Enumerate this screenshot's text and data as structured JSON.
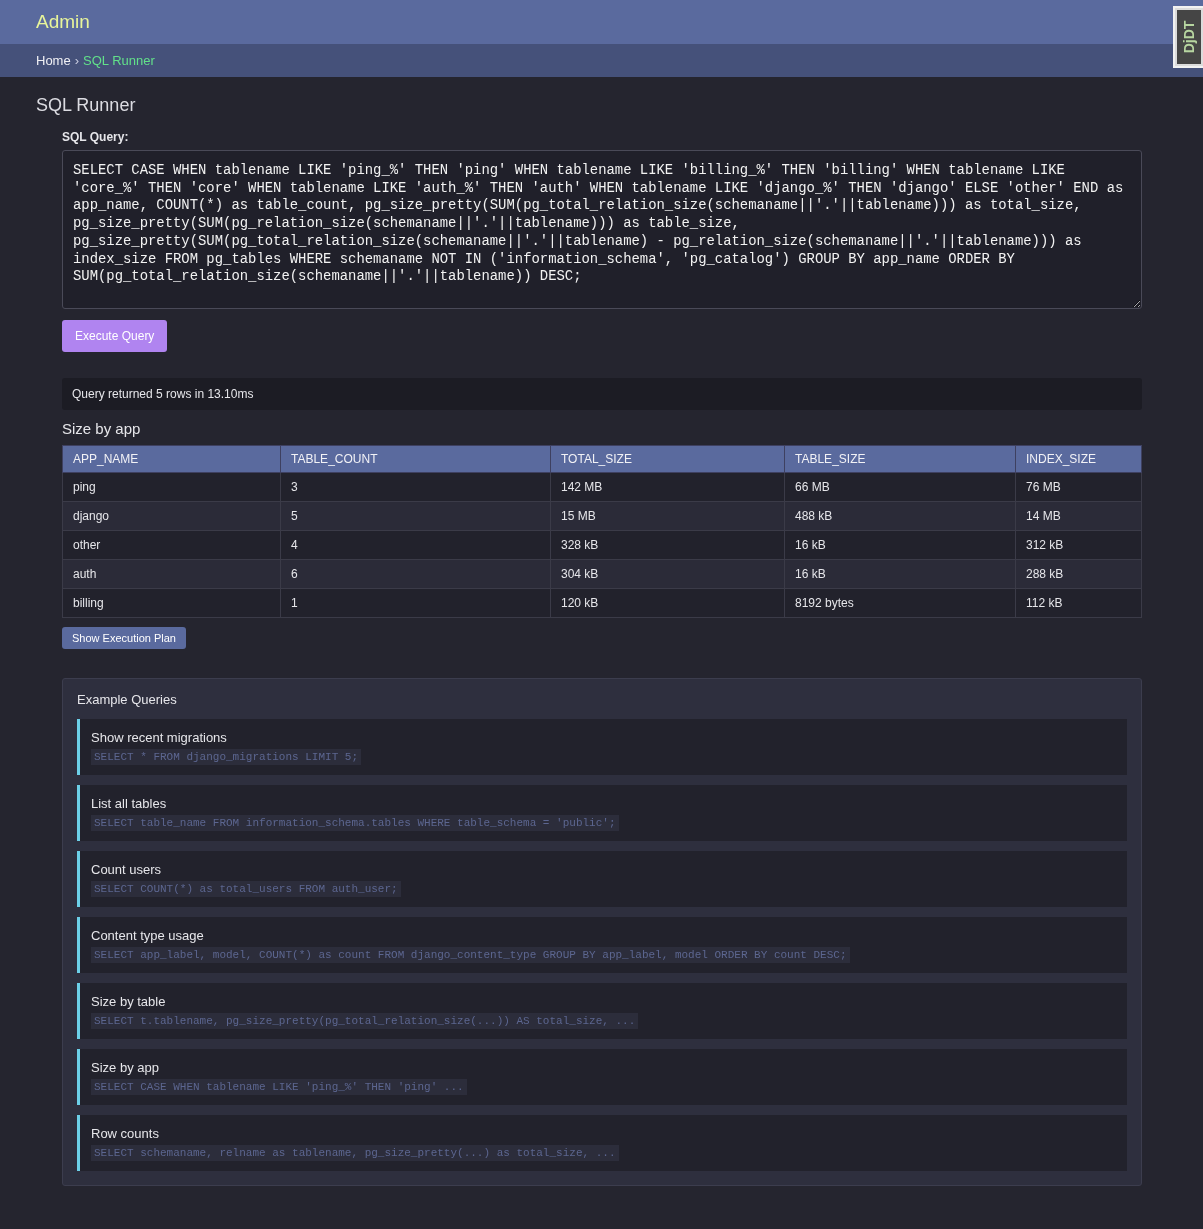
{
  "header": {
    "title": "Admin"
  },
  "breadcrumb": {
    "items": [
      {
        "label": "Home",
        "current": false
      },
      {
        "label": "SQL Runner",
        "current": true
      }
    ],
    "separator": "›"
  },
  "toolbar_handle": {
    "label": "DjDT"
  },
  "page_title": "SQL Runner",
  "query": {
    "label": "SQL Query:",
    "value": "SELECT CASE WHEN tablename LIKE 'ping_%' THEN 'ping' WHEN tablename LIKE 'billing_%' THEN 'billing' WHEN tablename LIKE 'core_%' THEN 'core' WHEN tablename LIKE 'auth_%' THEN 'auth' WHEN tablename LIKE 'django_%' THEN 'django' ELSE 'other' END as app_name, COUNT(*) as table_count, pg_size_pretty(SUM(pg_total_relation_size(schemaname||'.'||tablename))) as total_size, pg_size_pretty(SUM(pg_relation_size(schemaname||'.'||tablename))) as table_size, pg_size_pretty(SUM(pg_total_relation_size(schemaname||'.'||tablename) - pg_relation_size(schemaname||'.'||tablename))) as index_size FROM pg_tables WHERE schemaname NOT IN ('information_schema', 'pg_catalog') GROUP BY app_name ORDER BY SUM(pg_total_relation_size(schemaname||'.'||tablename)) DESC;",
    "button": "Execute Query"
  },
  "status": "Query returned 5 rows in 13.10ms",
  "result": {
    "title": "Size by app",
    "columns": [
      "APP_NAME",
      "TABLE_COUNT",
      "TOTAL_SIZE",
      "TABLE_SIZE",
      "INDEX_SIZE"
    ],
    "rows": [
      [
        "ping",
        "3",
        "142 MB",
        "66 MB",
        "76 MB"
      ],
      [
        "django",
        "5",
        "15 MB",
        "488 kB",
        "14 MB"
      ],
      [
        "other",
        "4",
        "328 kB",
        "16 kB",
        "312 kB"
      ],
      [
        "auth",
        "6",
        "304 kB",
        "16 kB",
        "288 kB"
      ],
      [
        "billing",
        "1",
        "120 kB",
        "8192 bytes",
        "112 kB"
      ]
    ],
    "plan_button": "Show Execution Plan"
  },
  "examples": {
    "title": "Example Queries",
    "items": [
      {
        "name": "Show recent migrations",
        "sql": "SELECT * FROM django_migrations LIMIT 5;"
      },
      {
        "name": "List all tables",
        "sql": "SELECT table_name FROM information_schema.tables WHERE table_schema = 'public';"
      },
      {
        "name": "Count users",
        "sql": "SELECT COUNT(*) as total_users FROM auth_user;"
      },
      {
        "name": "Content type usage",
        "sql": "SELECT app_label, model, COUNT(*) as count FROM django_content_type GROUP BY app_label, model ORDER BY count DESC;"
      },
      {
        "name": "Size by table",
        "sql": "SELECT t.tablename, pg_size_pretty(pg_total_relation_size(...)) AS total_size, ..."
      },
      {
        "name": "Size by app",
        "sql": "SELECT CASE WHEN tablename LIKE 'ping_%' THEN 'ping' ..."
      },
      {
        "name": "Row counts",
        "sql": "SELECT schemaname, relname as tablename, pg_size_pretty(...) as total_size, ..."
      }
    ]
  }
}
